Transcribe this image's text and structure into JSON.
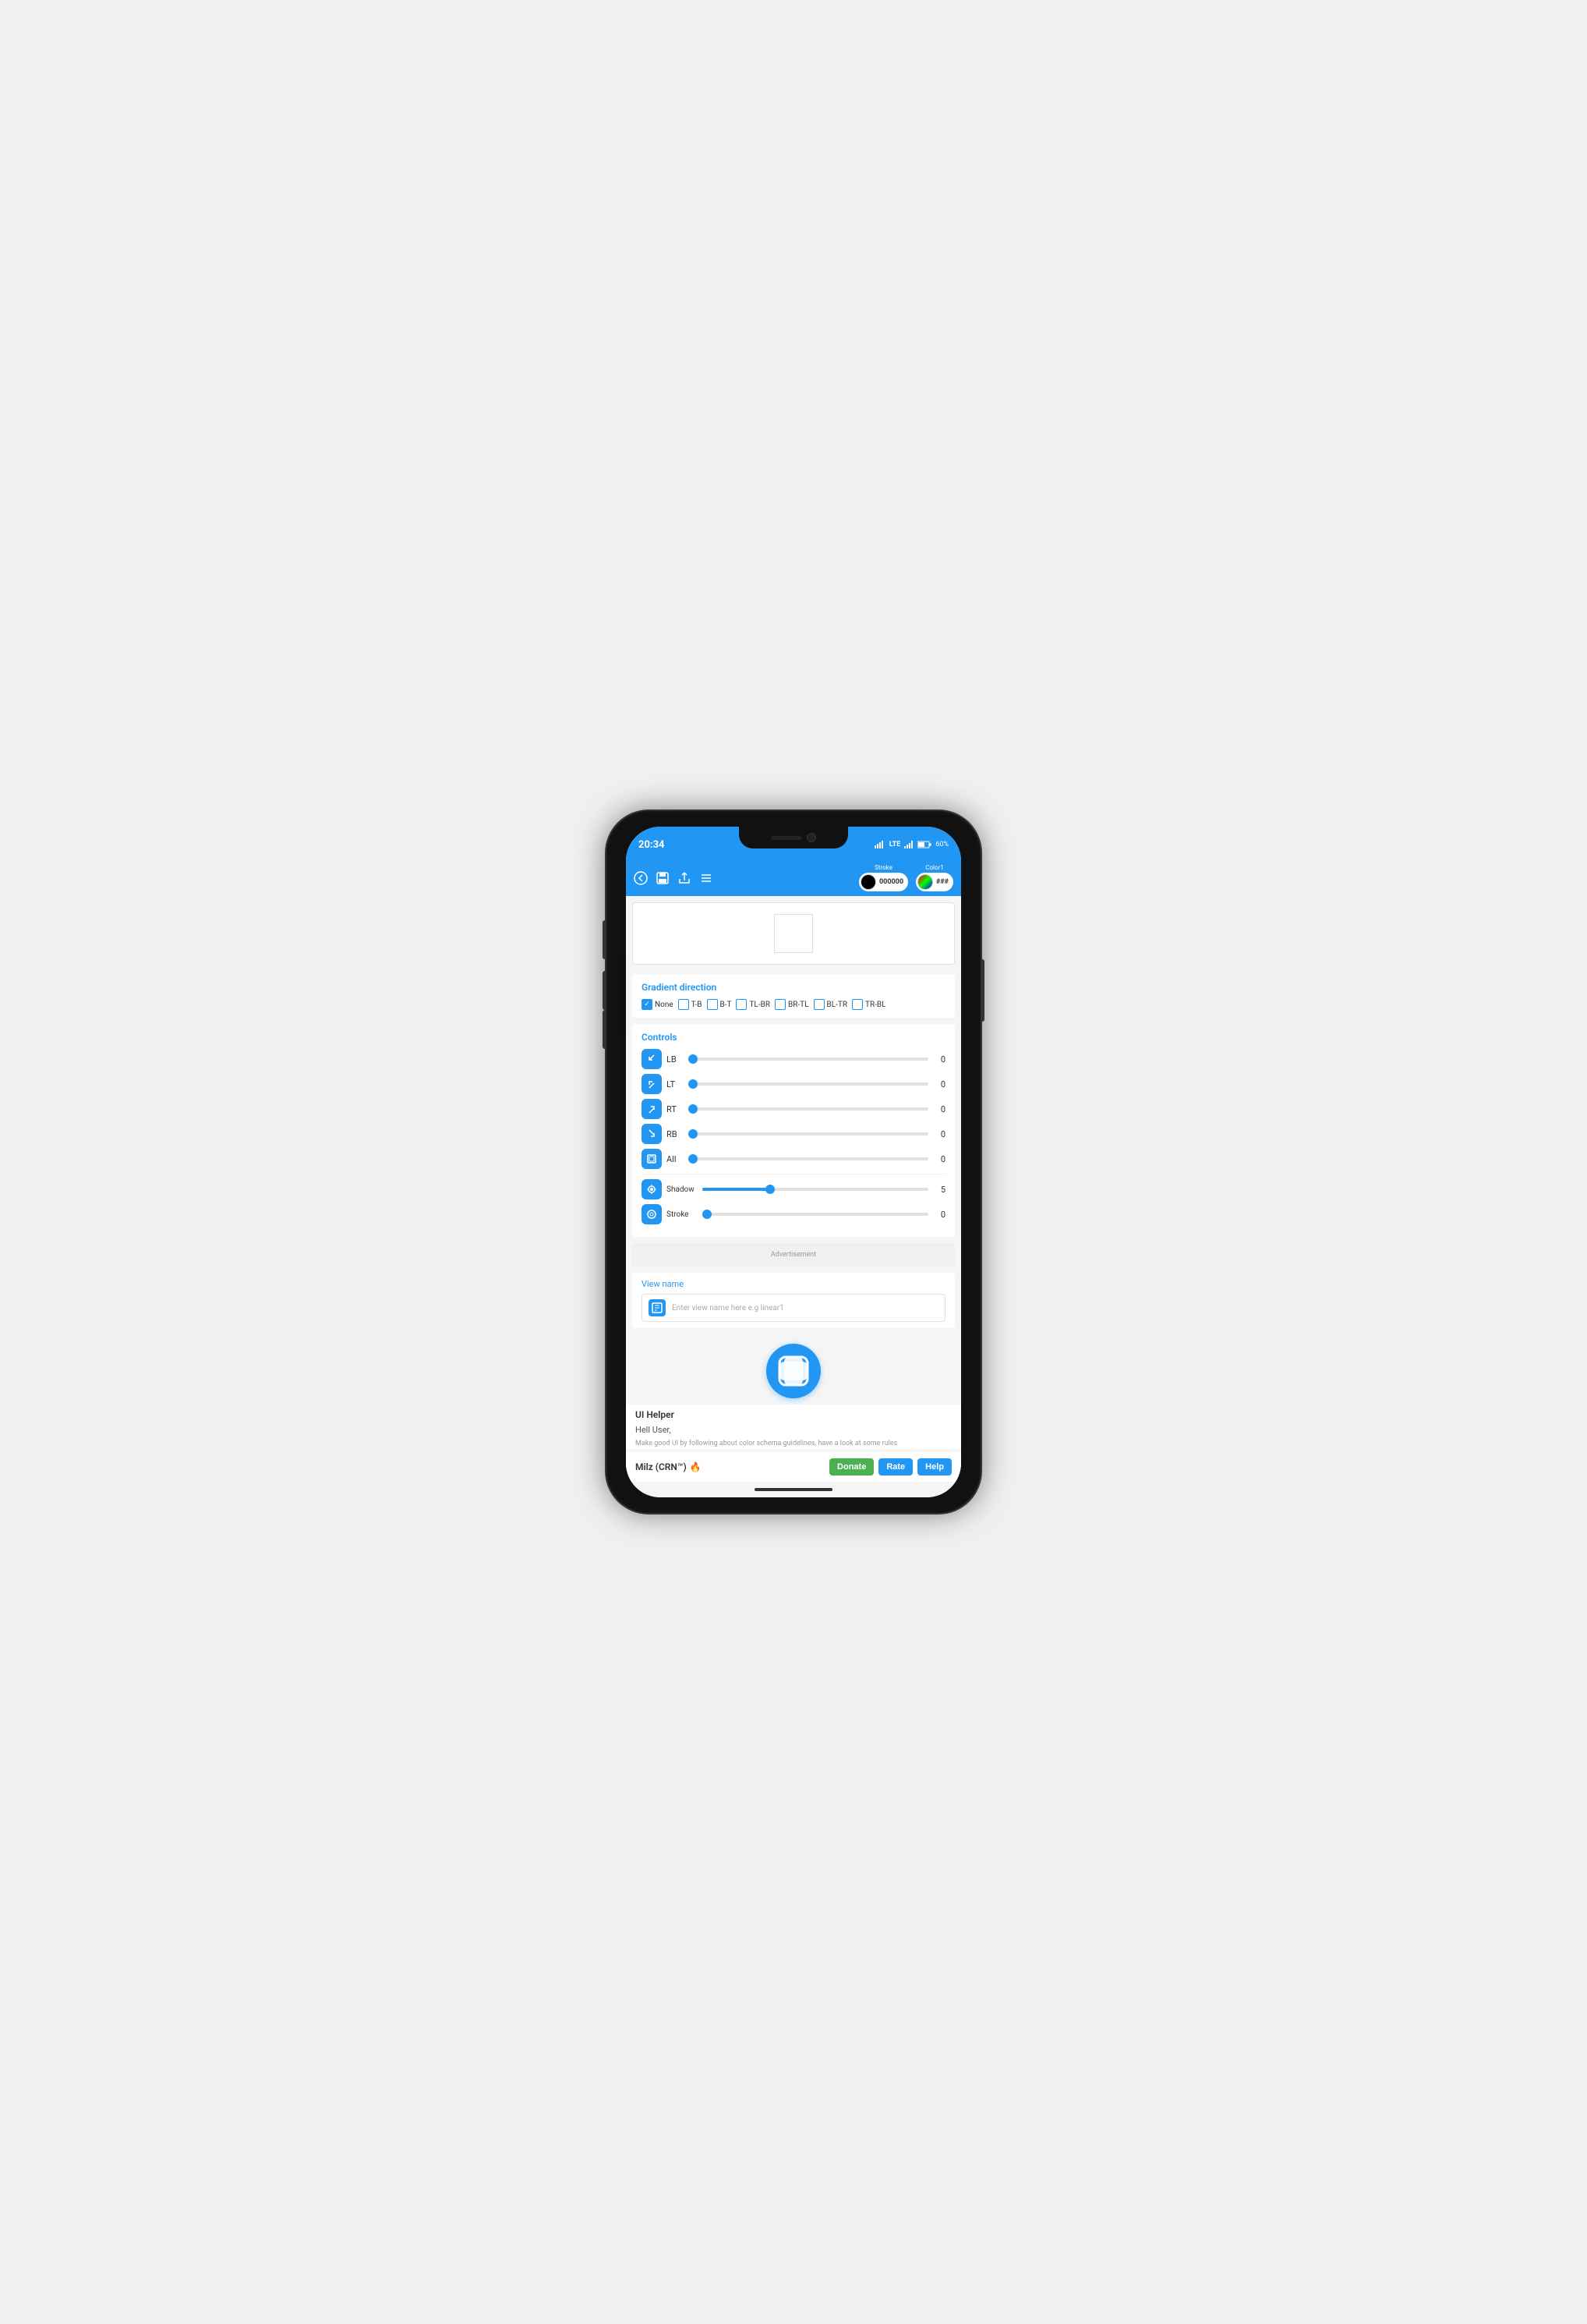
{
  "phone": {
    "status_bar": {
      "time": "20:34",
      "right_icons": "LTE 🔋 60%"
    },
    "toolbar": {
      "stroke_label": "Stroke",
      "stroke_color": "000000",
      "color1_label": "Color1",
      "color1_value": "###"
    },
    "gradient": {
      "section_title": "Gradient direction",
      "options": [
        "None",
        "T-B",
        "B-T",
        "TL-BR",
        "BR-TL",
        "BL-TR",
        "TR-BL"
      ],
      "checked": "None"
    },
    "controls": {
      "section_title": "Controls",
      "items": [
        {
          "icon": "LB",
          "label": "LB",
          "value": 0,
          "percent": 0
        },
        {
          "icon": "LT",
          "label": "LT",
          "value": 0,
          "percent": 0
        },
        {
          "icon": "RT",
          "label": "RT",
          "value": 0,
          "percent": 0
        },
        {
          "icon": "RB",
          "label": "RB",
          "value": 0,
          "percent": 0
        },
        {
          "icon": "All",
          "label": "All",
          "value": 0,
          "percent": 0
        },
        {
          "icon": "Shadow",
          "label": "Shadow",
          "value": 5,
          "percent": 30
        },
        {
          "icon": "Stroke",
          "label": "Stroke",
          "value": 0,
          "percent": 0
        }
      ]
    },
    "advertisement": {
      "label": "Advertisement"
    },
    "view_name": {
      "label": "View name",
      "placeholder": "Enter view name here e.g linear1"
    },
    "app_info": {
      "name": "UI Helper",
      "greeting": "Hell User,",
      "description": "Make good UI by following about color schema guidelines, have a look at some rules",
      "author": "Milz (CRN™)",
      "fire_emoji": "🔥"
    },
    "buttons": {
      "donate": "Donate",
      "rate": "Rate",
      "help": "Help"
    },
    "home_indicator": true
  }
}
